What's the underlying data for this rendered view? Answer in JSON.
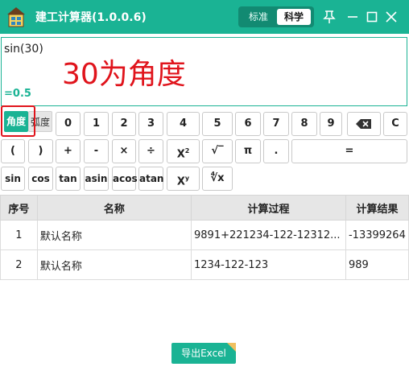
{
  "window": {
    "title": "建工计算器(1.0.0.6)",
    "mode_standard": "标准",
    "mode_scientific": "科学",
    "accent_color": "#1ab394"
  },
  "display": {
    "expression": "sin(30)",
    "result": "=0.5",
    "annotation": "30为角度"
  },
  "angle_mode": {
    "degree": "角度",
    "radian": "弧度",
    "selected": "角度"
  },
  "keys": {
    "row1": [
      "0",
      "1",
      "2",
      "3",
      "4",
      "5",
      "6",
      "7",
      "8",
      "9"
    ],
    "clear": "C",
    "open_paren": "(",
    "close_paren": ")",
    "plus": "+",
    "minus": "-",
    "multiply": "×",
    "divide": "÷",
    "square_base": "X",
    "square_exp": "2",
    "sqrt": "√‾",
    "pi": "π",
    "dot": ".",
    "equals": "=",
    "sin": "sin",
    "cos": "cos",
    "tan": "tan",
    "asin": "asin",
    "acos": "acos",
    "atan": "atan",
    "power_base": "X",
    "power_exp": "y",
    "root": "∜x"
  },
  "history": {
    "headers": [
      "序号",
      "名称",
      "计算过程",
      "计算结果"
    ],
    "rows": [
      [
        "1",
        "默认名称",
        "9891+221234-122-12312...",
        "-13399264"
      ],
      [
        "2",
        "默认名称",
        "1234-122-123",
        "989"
      ]
    ]
  },
  "export_button": "导出Excel",
  "icons": {
    "app": "calculator-house-icon",
    "pin": "pin-icon",
    "minimize": "minimize-icon",
    "maximize": "maximize-icon",
    "close": "close-icon",
    "backspace": "backspace-icon"
  }
}
